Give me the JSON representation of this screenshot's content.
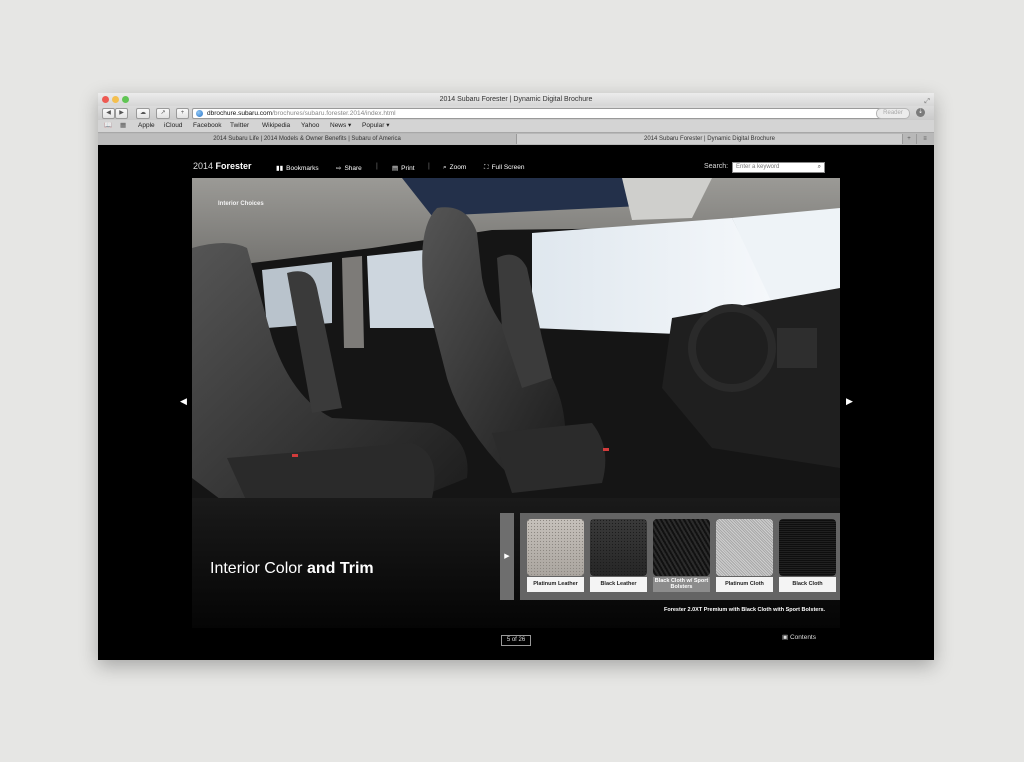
{
  "browser": {
    "window_title": "2014 Subaru Forester | Dynamic Digital Brochure",
    "address": {
      "host": "dbrochure.subaru.com",
      "path": "/brochures/subaru.forester.2014/index.html"
    },
    "reader_label": "Reader",
    "bookmarks": [
      "Apple",
      "iCloud",
      "Facebook",
      "Twitter",
      "Wikipedia",
      "Yahoo",
      "News ▾",
      "Popular ▾"
    ],
    "tabs": {
      "inactive": "2014 Subaru Life | 2014 Models & Owner Benefits | Subaru of America",
      "active": "2014 Subaru Forester | Dynamic Digital Brochure"
    }
  },
  "brochure_nav": {
    "brand_year": "2014",
    "brand_model": "Forester",
    "bookmarks_label": "Bookmarks",
    "share_label": "Share",
    "print_label": "Print",
    "zoom_label": "Zoom",
    "fullscreen_label": "Full Screen",
    "search_label": "Search:",
    "search_placeholder": "Enter a keyword"
  },
  "page": {
    "section_label": "Interior Choices",
    "headline_light": "Interior Color",
    "headline_bold": "and Trim",
    "caption": "Forester 2.0XT Premium with Black Cloth with Sport Bolsters.",
    "swatches": [
      {
        "label": "Platinum Leather",
        "texture": "platinum-leather",
        "selected": false
      },
      {
        "label": "Black Leather",
        "texture": "black-leather",
        "selected": false
      },
      {
        "label": "Black Cloth w/ Sport Bolsters",
        "texture": "black-cloth-sport",
        "selected": true
      },
      {
        "label": "Platinum Cloth",
        "texture": "platinum-cloth",
        "selected": false
      },
      {
        "label": "Black Cloth",
        "texture": "black-cloth",
        "selected": false
      }
    ]
  },
  "footer": {
    "page_indicator": "5 of 26",
    "contents_label": "Contents"
  },
  "colors": {
    "page_background": "#e6e6e4",
    "viewer_background": "#000000",
    "swatch_panel": "#646464"
  }
}
